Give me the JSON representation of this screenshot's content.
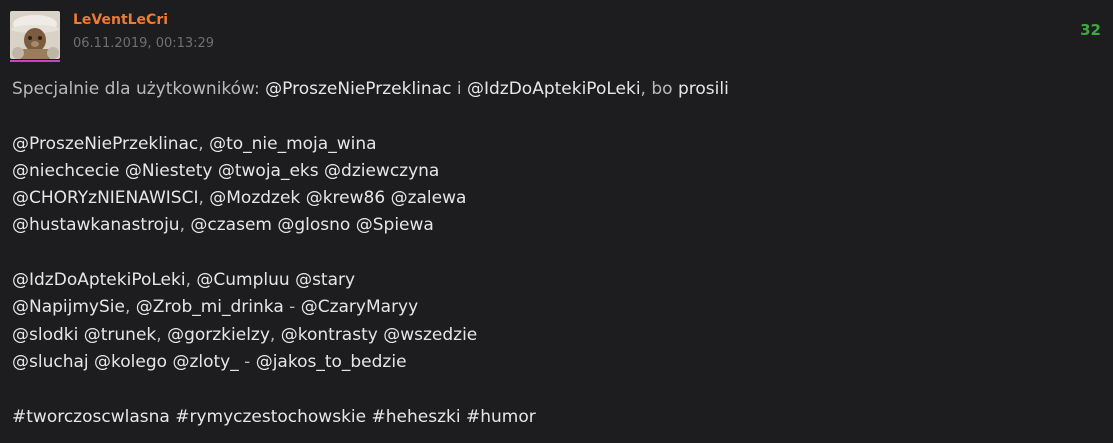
{
  "post": {
    "author": "LeVentLeCri",
    "timestamp": "06.11.2019, 00:13:29",
    "votes": "32",
    "lines": [
      [
        {
          "t": "Specjalnie dla użytkowników: ",
          "k": "plain"
        },
        {
          "t": "@ProszeNiePrzeklinac",
          "k": "mention"
        },
        {
          "t": " i ",
          "k": "plain"
        },
        {
          "t": "@IdzDoAptekiPoLeki",
          "k": "mention"
        },
        {
          "t": ", bo ",
          "k": "plain"
        },
        {
          "t": "prosili",
          "k": "mention"
        }
      ],
      [],
      [
        {
          "t": "@ProszeNiePrzeklinac",
          "k": "mention"
        },
        {
          "t": ", ",
          "k": "plain"
        },
        {
          "t": "@to_nie_moja_wina",
          "k": "mention"
        }
      ],
      [
        {
          "t": "@niechcecie",
          "k": "mention"
        },
        {
          "t": " ",
          "k": "plain"
        },
        {
          "t": "@Niestety",
          "k": "mention"
        },
        {
          "t": " ",
          "k": "plain"
        },
        {
          "t": "@twoja_eks",
          "k": "mention"
        },
        {
          "t": " ",
          "k": "plain"
        },
        {
          "t": "@dziewczyna",
          "k": "mention"
        }
      ],
      [
        {
          "t": "@CHORYzNIENAWISCI",
          "k": "mention"
        },
        {
          "t": ", ",
          "k": "plain"
        },
        {
          "t": "@Mozdzek",
          "k": "mention"
        },
        {
          "t": " ",
          "k": "plain"
        },
        {
          "t": "@krew86",
          "k": "mention"
        },
        {
          "t": " ",
          "k": "plain"
        },
        {
          "t": "@zalewa",
          "k": "mention"
        }
      ],
      [
        {
          "t": "@hustawkanastroju",
          "k": "mention"
        },
        {
          "t": ", ",
          "k": "plain"
        },
        {
          "t": "@czasem",
          "k": "mention"
        },
        {
          "t": " ",
          "k": "plain"
        },
        {
          "t": "@glosno",
          "k": "mention"
        },
        {
          "t": " ",
          "k": "plain"
        },
        {
          "t": "@Spiewa",
          "k": "mention"
        }
      ],
      [],
      [
        {
          "t": "@IdzDoAptekiPoLeki",
          "k": "mention"
        },
        {
          "t": ", ",
          "k": "plain"
        },
        {
          "t": "@Cumpluu",
          "k": "mention"
        },
        {
          "t": " ",
          "k": "plain"
        },
        {
          "t": "@stary",
          "k": "mention"
        }
      ],
      [
        {
          "t": "@NapijmySie",
          "k": "mention"
        },
        {
          "t": ", ",
          "k": "plain"
        },
        {
          "t": "@Zrob_mi_drinka",
          "k": "mention"
        },
        {
          "t": " - ",
          "k": "plain"
        },
        {
          "t": "@CzaryMaryy",
          "k": "mention"
        }
      ],
      [
        {
          "t": "@slodki",
          "k": "mention"
        },
        {
          "t": " ",
          "k": "plain"
        },
        {
          "t": "@trunek",
          "k": "mention"
        },
        {
          "t": ", ",
          "k": "plain"
        },
        {
          "t": "@gorzkielzy",
          "k": "mention"
        },
        {
          "t": ", ",
          "k": "plain"
        },
        {
          "t": "@kontrasty",
          "k": "mention"
        },
        {
          "t": " ",
          "k": "plain"
        },
        {
          "t": "@wszedzie",
          "k": "mention"
        }
      ],
      [
        {
          "t": "@sluchaj",
          "k": "mention"
        },
        {
          "t": " ",
          "k": "plain"
        },
        {
          "t": "@kolego",
          "k": "mention"
        },
        {
          "t": " ",
          "k": "plain"
        },
        {
          "t": "@zloty_",
          "k": "mention"
        },
        {
          "t": " - ",
          "k": "plain"
        },
        {
          "t": "@jakos_to_bedzie",
          "k": "mention"
        }
      ],
      [],
      [
        {
          "t": "#tworczoscwlasna",
          "k": "tag"
        },
        {
          "t": " ",
          "k": "plain"
        },
        {
          "t": "#rymyczestochowskie",
          "k": "tag"
        },
        {
          "t": " ",
          "k": "plain"
        },
        {
          "t": "#heheszki",
          "k": "tag"
        },
        {
          "t": " ",
          "k": "plain"
        },
        {
          "t": "#humor",
          "k": "tag"
        }
      ]
    ]
  },
  "colors": {
    "background": "#1d1d1f",
    "author": "#ee7b32",
    "votes": "#3fa73f",
    "avatar_underline": "#c447c0",
    "text": "#c8c8c8",
    "muted": "#6f6f73"
  }
}
